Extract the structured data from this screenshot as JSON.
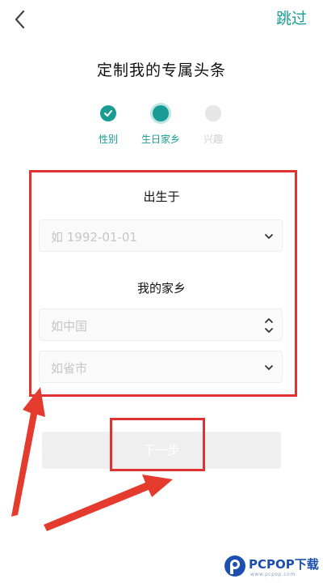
{
  "header": {
    "back_icon": "chevron-left-icon",
    "skip_label": "跳过"
  },
  "title": "定制我的专属头条",
  "steps": [
    {
      "label": "性别",
      "state": "done"
    },
    {
      "label": "生日家乡",
      "state": "current"
    },
    {
      "label": "兴趣",
      "state": "todo"
    }
  ],
  "form": {
    "birth_label": "出生于",
    "birth_placeholder": "如 1992-01-01",
    "hometown_label": "我的家乡",
    "province_placeholder": "如中国",
    "city_placeholder": "如省市"
  },
  "next_button_label": "下一步",
  "watermark": {
    "brand": "PCPOP下载",
    "sub": "www.pcpop.com"
  },
  "colors": {
    "accent": "#1a9c94",
    "annotation_red": "#e03232"
  }
}
